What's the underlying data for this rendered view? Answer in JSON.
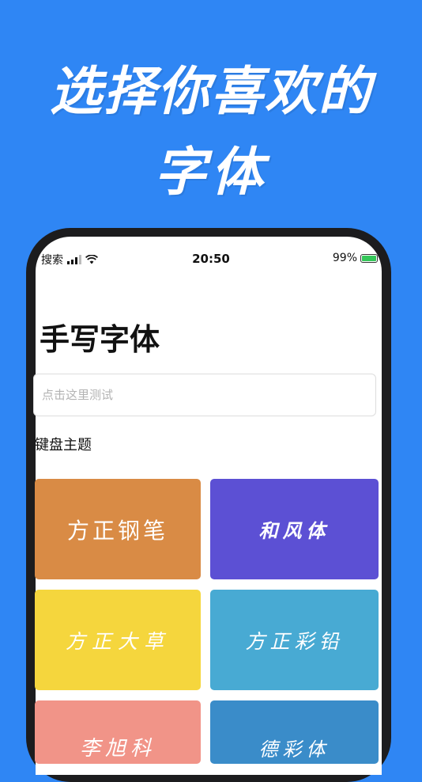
{
  "headline": {
    "line1": "选择你喜欢的",
    "line2": "字体"
  },
  "status_bar": {
    "back_app": "搜索",
    "time": "20:50",
    "battery": "99%"
  },
  "page": {
    "title": "手写字体",
    "search_placeholder": "点击这里测试",
    "section_title": "键盘主题"
  },
  "fonts": [
    {
      "label": "方正钢笔",
      "color": "#d98b45"
    },
    {
      "label": "和风体",
      "color": "#5c50d4"
    },
    {
      "label": "方正大草",
      "color": "#f5d63d"
    },
    {
      "label": "方正彩铅",
      "color": "#48aad3"
    },
    {
      "label": "李旭科",
      "color": "#f19488"
    },
    {
      "label": "德彩体",
      "color": "#3a8cc9"
    }
  ]
}
